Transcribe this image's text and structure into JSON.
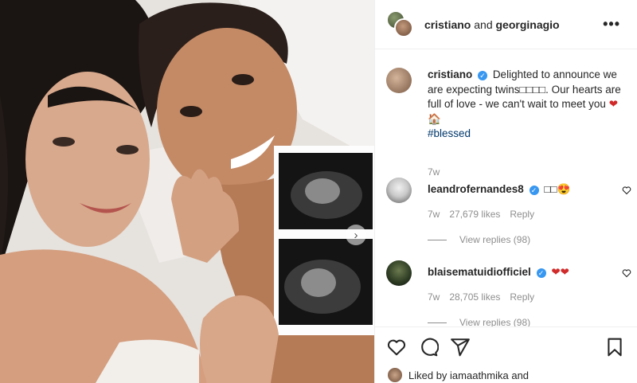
{
  "header": {
    "user1": "cristiano",
    "connector": "and",
    "user2": "georginagio",
    "more_icon": "ellipsis-icon"
  },
  "photo": {
    "next_icon": "chevron-right-icon",
    "next_glyph": "›"
  },
  "caption": {
    "username": "cristiano",
    "verified": true,
    "verified_glyph": "✓",
    "text": "Delighted to announce we are expecting twins□□□□. Our hearts are full of love - we can't wait to meet you",
    "heart": "❤",
    "house": "🏠",
    "hashtag": "#blessed",
    "time": "7w"
  },
  "comments": [
    {
      "username": "leandrofernandes8",
      "verified": true,
      "text": "□□😍",
      "time": "7w",
      "likes": "27,679 likes",
      "reply": "Reply",
      "view_replies": "View replies (98)"
    },
    {
      "username": "blaisematuidiofficiel",
      "verified": true,
      "text": "❤❤",
      "time": "7w",
      "likes": "28,705 likes",
      "reply": "Reply",
      "view_replies": "View replies (98)"
    }
  ],
  "actions": {
    "like_icon": "heart-icon",
    "comment_icon": "comment-icon",
    "share_icon": "share-icon",
    "save_icon": "bookmark-icon"
  },
  "likes_summary": "Liked by iamaathmika and"
}
